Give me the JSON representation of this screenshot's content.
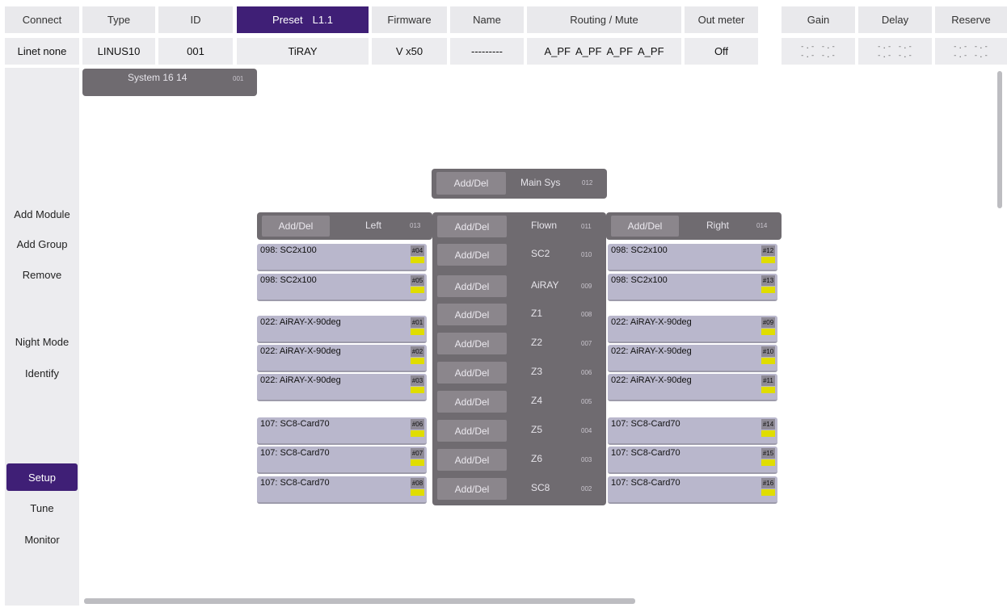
{
  "header": {
    "labels": {
      "connect": "Connect",
      "type": "Type",
      "id": "ID",
      "preset": "Preset",
      "preset_value": "L1.1",
      "firmware": "Firmware",
      "name": "Name",
      "routing": "Routing / Mute",
      "out_meter": "Out meter",
      "gain": "Gain",
      "delay": "Delay",
      "reserve": "Reserve"
    },
    "values": {
      "connect": "Linet none",
      "type": "LINUS10",
      "id": "001",
      "preset": "TiRAY",
      "firmware": "V x50",
      "name": "---------",
      "routing": [
        "A_PF",
        "A_PF",
        "A_PF",
        "A_PF"
      ],
      "out_meter": "Off",
      "gain_line1": "-.- -.-",
      "gain_line2": "-.- -.-",
      "delay_line1": "-.- -.-",
      "delay_line2": "-.- -.-",
      "reserve_line1": "-.- -.-",
      "reserve_line2": "-.- -.-"
    }
  },
  "sidebar": {
    "add_module": "Add Module",
    "add_group": "Add Group",
    "remove": "Remove",
    "night_mode": "Night Mode",
    "identify": "Identify",
    "setup": "Setup",
    "tune": "Tune",
    "monitor": "Monitor",
    "active": "setup"
  },
  "system": {
    "title": "System 16 14",
    "num": "001"
  },
  "add_del": "Add/Del",
  "groups": {
    "main": {
      "label": "Main Sys",
      "num": "012"
    },
    "left": {
      "label": "Left",
      "num": "013"
    },
    "right": {
      "label": "Right",
      "num": "014"
    },
    "center": [
      {
        "label": "Flown",
        "num": "011"
      },
      {
        "label": "SC2",
        "num": "010"
      },
      {
        "label": "AiRAY",
        "num": "009"
      },
      {
        "label": "Z1",
        "num": "008"
      },
      {
        "label": "Z2",
        "num": "007"
      },
      {
        "label": "Z3",
        "num": "006"
      },
      {
        "label": "Z4",
        "num": "005"
      },
      {
        "label": "Z5",
        "num": "004"
      },
      {
        "label": "Z6",
        "num": "003"
      },
      {
        "label": "SC8",
        "num": "002"
      }
    ]
  },
  "modules_left": [
    {
      "name": "098: SC2x100",
      "num": "#04"
    },
    {
      "name": "098: SC2x100",
      "num": "#05"
    },
    {
      "name": "022: AiRAY-X-90deg",
      "num": "#01"
    },
    {
      "name": "022: AiRAY-X-90deg",
      "num": "#02"
    },
    {
      "name": "022: AiRAY-X-90deg",
      "num": "#03"
    },
    {
      "name": "107: SC8-Card70",
      "num": "#06"
    },
    {
      "name": "107: SC8-Card70",
      "num": "#07"
    },
    {
      "name": "107: SC8-Card70",
      "num": "#08"
    }
  ],
  "modules_right": [
    {
      "name": "098: SC2x100",
      "num": "#12"
    },
    {
      "name": "098: SC2x100",
      "num": "#13"
    },
    {
      "name": "022: AiRAY-X-90deg",
      "num": "#09"
    },
    {
      "name": "022: AiRAY-X-90deg",
      "num": "#10"
    },
    {
      "name": "022: AiRAY-X-90deg",
      "num": "#11"
    },
    {
      "name": "107: SC8-Card70",
      "num": "#14"
    },
    {
      "name": "107: SC8-Card70",
      "num": "#15"
    },
    {
      "name": "107: SC8-Card70",
      "num": "#16"
    }
  ],
  "colors": {
    "accent": "#3f1f76",
    "group": "#6f6b70",
    "module": "#b9b7cc",
    "level_indicator": "#e0dd00"
  }
}
